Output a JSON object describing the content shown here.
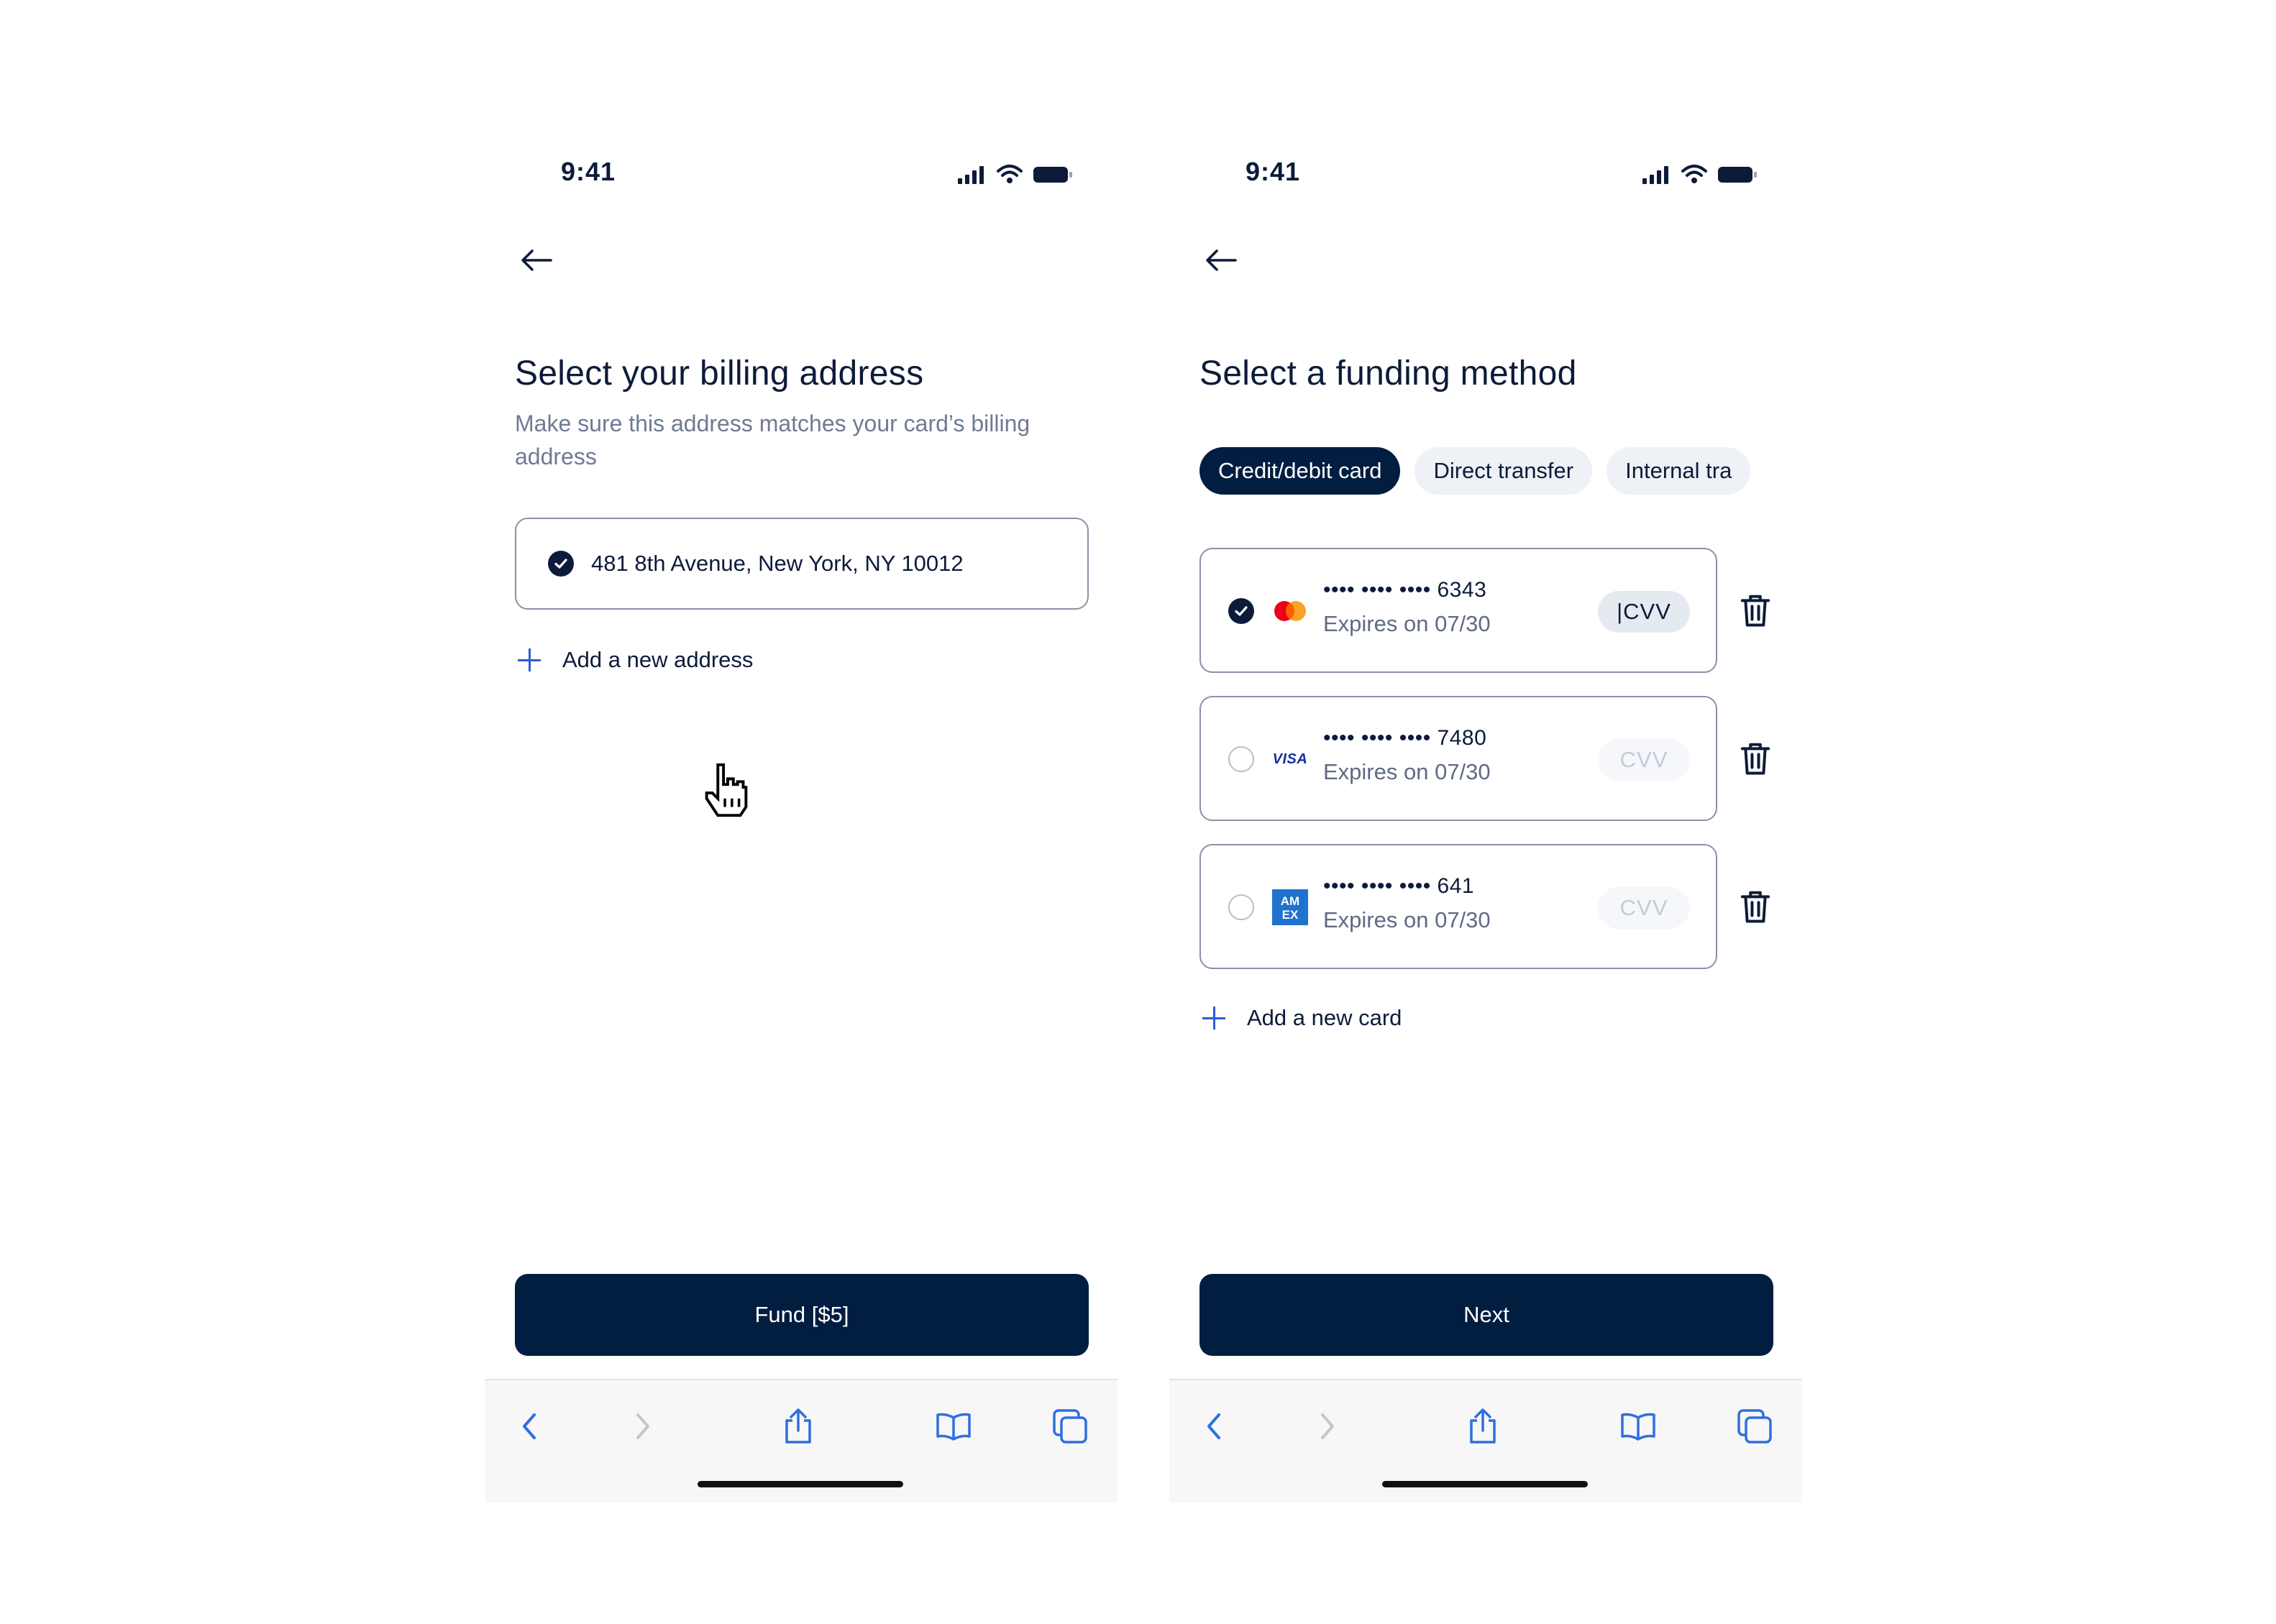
{
  "left_screen": {
    "status_time": "9:41",
    "title": "Select your billing address",
    "subtitle": "Make sure this address matches your card’s billing address",
    "address": "481 8th Avenue, New York, NY 10012",
    "add_address_label": "Add a new address",
    "primary_button_label": "Fund [$5]"
  },
  "right_screen": {
    "status_time": "9:41",
    "title": "Select a funding method",
    "tabs": [
      {
        "label": "Credit/debit card",
        "active": true
      },
      {
        "label": "Direct transfer",
        "active": false
      },
      {
        "label": "Internal tra",
        "active": false
      }
    ],
    "cards": [
      {
        "brand": "mastercard",
        "number": "•••• •••• •••• 6343",
        "expiry": "Expires on 07/30",
        "cvv": "|CVV",
        "selected": true
      },
      {
        "brand": "visa",
        "brand_text": "VISA",
        "number": "•••• •••• •••• 7480",
        "expiry": "Expires on 07/30",
        "cvv": "CVV",
        "selected": false
      },
      {
        "brand": "amex",
        "brand_text": "AM EX",
        "number": "•••• •••• •••• 641",
        "expiry": "Expires on 07/30",
        "cvv": "CVV",
        "selected": false
      }
    ],
    "add_card_label": "Add a new card",
    "primary_button_label": "Next"
  },
  "icons": {
    "status": [
      "signal-icon",
      "wifi-icon",
      "battery-icon"
    ],
    "browser": [
      "back-chevron-icon",
      "forward-chevron-icon",
      "share-icon",
      "bookmarks-icon",
      "tabs-icon"
    ],
    "misc": [
      "back-arrow-icon",
      "check-icon",
      "plus-icon",
      "trash-icon",
      "hand-cursor-icon"
    ]
  },
  "colors": {
    "navy": "#011d40",
    "text": "#0d1b3a",
    "muted": "#6f7a94",
    "accent_blue": "#2f5bd6",
    "border": "#8b92a6"
  }
}
